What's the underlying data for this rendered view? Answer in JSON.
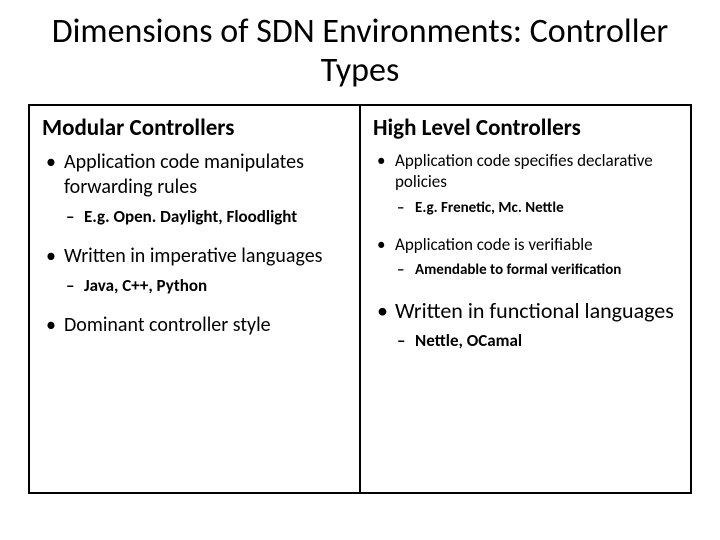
{
  "title": "Dimensions of SDN Environments: Controller Types",
  "left": {
    "heading": "Modular Controllers",
    "b1": "Application code manipulates forwarding rules",
    "b1_sub": "E.g. Open. Daylight, Floodlight",
    "b2": "Written in imperative languages",
    "b2_sub": "Java, C++, Python",
    "b3": "Dominant controller style"
  },
  "right": {
    "heading": "High Level Controllers",
    "b1": "Application code specifies declarative policies",
    "b1_sub": "E.g. Frenetic, Mc. Nettle",
    "b2": "Application code is verifiable",
    "b2_sub": "Amendable to formal verification",
    "b3": "Written in functional languages",
    "b3_sub": "Nettle, OCamal"
  }
}
